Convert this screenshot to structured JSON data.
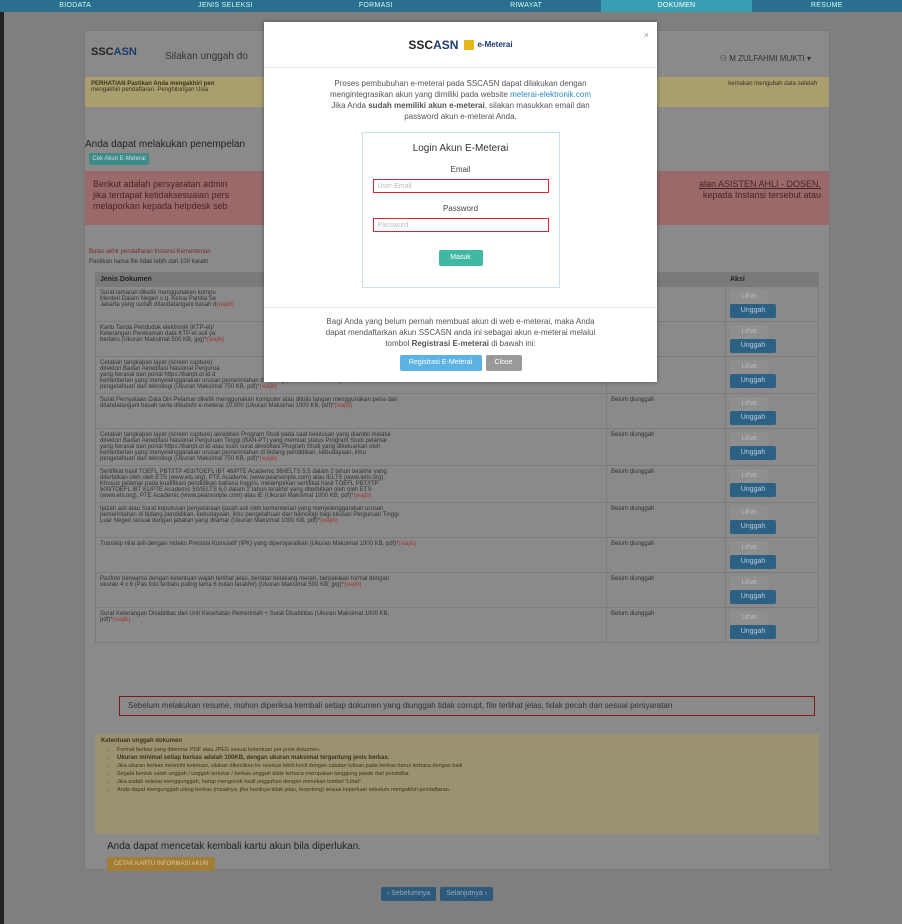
{
  "topbar": {
    "steps": [
      "BIODATA",
      "JENIS SELEKSI",
      "FORMASI",
      "RIWAYAT",
      "DOKUMEN",
      "RESUME"
    ],
    "active_index": 4
  },
  "header": {
    "logo_text": "SSC",
    "logo_asn": "ASN",
    "instruction": "Silakan unggah do",
    "user_name": "M ZULFAHMI MUKTI"
  },
  "alert_yellow": {
    "left": "PERHATIAN Pastikan Anda mengakhiri pen",
    "left2": "mengakhiri pendaftaran. Penghitungan Usia",
    "right": "kemakan mengubah data setelah"
  },
  "emeterai_section": {
    "title": "Anda dapat melakukan penempelan",
    "cek_button": "Cek Akun E-Meterai"
  },
  "alert_red": {
    "left1": "Berikut adalah persyaratan admin",
    "left2": "jika terdapat ketidaksesuaian pers",
    "left3": "melaporkan kepada helpdesk seb",
    "right1": "alan ASISTEN AHLI - DOSEN.",
    "right2": "kepada Instansi tersebut atau"
  },
  "batas": "Batas akhir pendaftaran Instansi Kementerian",
  "pasfoto_note": "Pastikan nama file tidak lebih dari 100 karakt",
  "table": {
    "headers": [
      "Jenis Dokumen",
      "",
      "Aksi"
    ],
    "lihat_label": "Lihat",
    "unggah_label": "Unggah",
    "rows": [
      {
        "desc": "Surat lamaran diketik menggunakan kompu\nMenteri Dalam Negeri c.q. Ketua Panitia Se\nJakarta yang sudah ditandatangani basah d",
        "wajib": "(wajib)",
        "status": ""
      },
      {
        "desc": "Kartu Tanda Penduduk elektronik (KTP-el)/\nKeterangan Perekaman data KTP-el asli ya\nberlaku (Ukuran Maksimal 500 KB, jpg)*",
        "wajib": "(wajib)",
        "status": ""
      },
      {
        "desc": "Cetakan tangkapan layar (screen capture)\ndirektori Badan Akreditasi Nasional Pergurua\nyang berasal dari portal https://banpt.or.id d\nkementerian yang menyelenggarakan urusan pemerintahan di bidang pendidikan, kebudayaan, ilmu\npengetahuan dan teknologi (Ukuran Maksimal 750 KB, pdf)*",
        "wajib": "(wajib)",
        "status": ""
      },
      {
        "desc": "Surat Pernyataan Data Diri Pelamar diketik menggunakan komputer atau ditulis tangan menggunakan pena dan\nditandatangani basah serta dibubuhi e-meterai 10.000 (Ukuran Maksimal 1000 KB, pdf)*",
        "wajib": "(wajib)",
        "status": "Belum diunggah"
      },
      {
        "desc": "Cetakan tangkapan layar (screen capture) akreditasi Program Studi pada saat kelulusan yang diambil melalui\ndirektori Badan Akreditasi Nasional Perguruan Tinggi (BAN-PT) yang memuat status Program Studi pelamar\nyang berasal dari portal https://banpt.or.id atau scan surat akreditasi Program Studi yang dikeluarkan oleh\nkementerian yang menyelenggarakan urusan pemerintahan di bidang pendidikan, kebudayaan, ilmu\npengetahuan dan teknologi (Ukuran Maksimal 750 KB, pdf)*",
        "wajib": "(wajib)",
        "status": "Belum diunggah"
      },
      {
        "desc": "Sertifikat hasil TOEFL PBT/ITP 453/TOEFL iBT 46/PTE Academic 36/IELTS 5,5 dalam 2 tahun terakhir yang\nditerbitkan oleh oleh ETS (www.ets.org), PTE Academic (www.pearsonpte.com) atau IELTS (www.ielts.org).\nKhusus pelamar pada kualifikasi pendidikan bahasa Inggris, melampirkan sertifikat hasil TOEFL PBT/ITP\n500/TOEFL iBT 61/PTE Academic 50/IELTS 6,0 dalam 2 tahun terakhir yang diterbitkan oleh oleh ETS\n(www.ets.org), PTE Academic (www.pearsonpte.com) atau IE (Ukuran Maksimal 1000 KB, pdf)*",
        "wajib": "(wajib)",
        "status": "Belum diunggah"
      },
      {
        "desc": "Ijazah asli atau Surat keputusan penyetaraan ijazah asli oleh kementerian yang menyelenggarakan urusan\npemerintahan di bidang pendidikan, kebudayaan, ilmu pengetahuan dan teknologi bagi lulusan Perguruan Tinggi\nLuar Negeri sesuai dengan jabatan yang dilamar (Ukuran Maksimal 1000 KB, pdf)*",
        "wajib": "(wajib)",
        "status": "Belum diunggah"
      },
      {
        "desc": "Transkip nilai asli dengan Indeks Prestasi Kumulatif (IPK) yang dipersyaratkan (Ukuran Maksimal 1000 KB, pdf)*",
        "wajib": "(wajib)",
        "status": "Belum diunggah"
      },
      {
        "desc": "Pasfoto berwarna dengan ketentuan wajah terlihat jelas, berlatar belakang merah, berpakaian formal dengan\nukuran 4 x 6 (Pas foto terbaru paling lama 6 bulan terakhir) (Ukuran Maksimal 500 KB, jpg)*",
        "wajib": "(wajib)",
        "status": "Belum diunggah"
      },
      {
        "desc": "Surat Keterangan Disabilitas dari Unit Kesehatan Pemerintah + Surat Disabilitas (Ukuran Maksimal 1000 KB,\npdf)*",
        "wajib": "(wajib)",
        "status": "Belum diunggah"
      }
    ]
  },
  "resume_warning": "Sebelum melakukan resume, mohon diperiksa kembali setiap dokumen yang diunggah tidak corrupt, file terlihat jelas, tidak pecah dan sesuai persyaratan",
  "ketentuan": {
    "title": "Ketentuan unggah dokumen",
    "items": [
      "Format berkas yang diterima: PDF atau JPEG sesuai ketentuan per jenis dokumen.",
      "Ukuran minimal setiap berkas adalah 100KB, dengan ukuran maksimal tergantung jenis berkas.",
      "Jika ukuran berkas melebihi ketetuan, silakan dikecilkan ke resolusi lebih kecil dengan catatan tulisan pada berkas harus terbaca dengan baik",
      "Segala bentuk salah unggah / unggah tertukar / berkas unggah tidak terbaca merupakan tanggung jawab dari pendaftar.",
      "Jika sudah selesai menggunggah, harap mengecek hasil unggahan dengan menekan tombol \"Lihat\".",
      "Anda dapat mengunggah ulang berkas (misalnya: jika hasilnya tidak jelas, terpotong) sesuai keperluan sebelum mengakhiri pendaftaran."
    ]
  },
  "cetak": {
    "text": "Anda dapat mencetak kembali kartu akun bila diperlukan.",
    "button": "CETAK KARTU INFORMASI AKUN"
  },
  "pager": {
    "prev": "‹ Sebelumnya",
    "next": "Selanjutnya ›"
  },
  "modal": {
    "close": "×",
    "logo_text": "SSC",
    "logo_asn": "ASN",
    "emeterai_label": "e-Meterai",
    "body1": "Proses pembubuhan e-meterai pada SSCASN dapat dilakukan dengan",
    "body2_pre": "mengintegrasikan akun yang dimiliki pada website",
    "body2_link": "meterai-elektronik.com",
    "body3_pre": "Jika Anda",
    "body3_bold": "sudah memiliki akun e-meterai",
    "body3_post": ", silakan masukkan email dan",
    "body4": "password akun e-meterai Anda.",
    "login_title": "Login Akun E-Meterai",
    "email_label": "Email",
    "email_placeholder": "User Email",
    "password_label": "Password",
    "password_placeholder": "Password",
    "masuk": "Masuk",
    "foot1": "Bagi Anda yang belum pernah membuat akun di web e-meterai, maka Anda",
    "foot2": "dapat mendaftarkan akun SSCASN anda ini sebagai akun e-meterai melalui",
    "foot3_pre": "tombol",
    "foot3_bold": "Registrasi E-meterai",
    "foot3_post": "di bawah ini:",
    "register_button": "Registrasi E-Meterai",
    "close_button": "Close"
  }
}
